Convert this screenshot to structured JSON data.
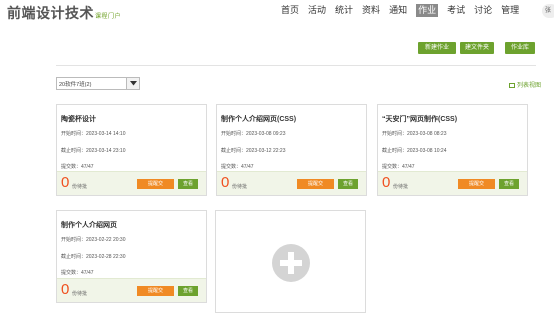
{
  "header": {
    "logo": "前端设计技术",
    "logo_sub": "课程门户",
    "nav": [
      "首页",
      "活动",
      "统计",
      "资料",
      "通知",
      "作业",
      "考试",
      "讨论",
      "管理"
    ],
    "avatar": "张"
  },
  "toolbar": {
    "new_homework": "新建作业",
    "new_folder": "建文件夹",
    "homework_library": "作业库",
    "class_select": "20软件7班(2)",
    "list_view": "列表视图"
  },
  "cards": [
    {
      "title": "陶瓷杯设计",
      "start": "开始时间：2023-03-14 14:10",
      "end": "截止时间：2023-03-14 23:10",
      "submitted": "提交数：47/47",
      "count": "0",
      "count_label": "份待批",
      "remind": "提醒交",
      "view": "查看"
    },
    {
      "title": "制作个人介绍网页(CSS)",
      "start": "开始时间：2023-03-08 09:23",
      "end": "截止时间：2023-03-12 22:23",
      "submitted": "提交数：47/47",
      "count": "0",
      "count_label": "份待批",
      "remind": "提醒交",
      "view": "查看"
    },
    {
      "title": "“天安门”网页制作(CSS)",
      "start": "开始时间：2023-03-08 08:23",
      "end": "截止时间：2023-03-08 10:24",
      "submitted": "提交数：47/47",
      "count": "0",
      "count_label": "份待批",
      "remind": "提醒交",
      "view": "查看"
    },
    {
      "title": "制作个人介绍网页",
      "start": "开始时间：2023-02-22 20:30",
      "end": "截止时间：2023-02-28 22:30",
      "submitted": "提交数：47/47",
      "count": "0",
      "count_label": "份待批",
      "remind": "提醒交",
      "view": "查看"
    }
  ],
  "colors": {
    "accent_green": "#6da22e",
    "accent_orange": "#f08a24",
    "count_red": "#f0501f"
  }
}
